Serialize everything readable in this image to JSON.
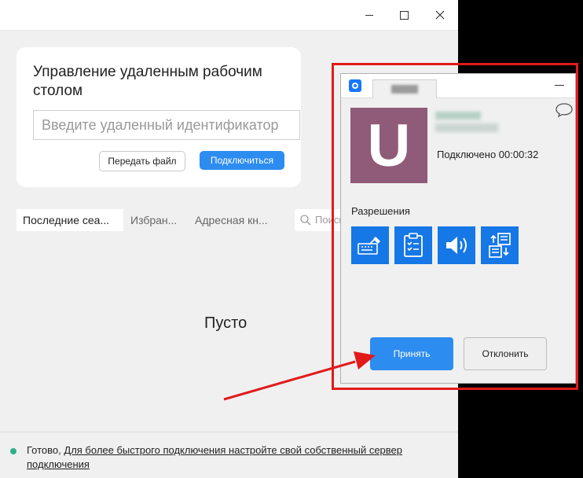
{
  "main": {
    "card_title": "Управление удаленным рабочим столом",
    "id_placeholder": "Введите удаленный идентификатор",
    "send_file_label": "Передать файл",
    "connect_label": "Подключиться",
    "tabs": [
      {
        "label": "Последние сеа..."
      },
      {
        "label": "Избран..."
      },
      {
        "label": "Адресная кн..."
      }
    ],
    "search_placeholder": "Поиск",
    "empty_text": "Пусто",
    "status": {
      "ready": "Готово,",
      "link": "Для более быстрого подключения настройте свой собственный сервер подключения"
    }
  },
  "popup": {
    "avatar_letter": "U",
    "connected_text": "Подключено 00:00:32",
    "permissions_label": "Разрешения",
    "permissions": [
      {
        "icon": "keyboard-icon"
      },
      {
        "icon": "clipboard-icon"
      },
      {
        "icon": "speaker-icon"
      },
      {
        "icon": "file-transfer-icon"
      }
    ],
    "accept_label": "Принять",
    "decline_label": "Отклонить"
  },
  "colors": {
    "accent": "#2d8cf0",
    "permission_blue": "#1677e6",
    "avatar": "#8f5b78",
    "highlight": "#e21a1a",
    "status_ok": "#2bb08a"
  }
}
